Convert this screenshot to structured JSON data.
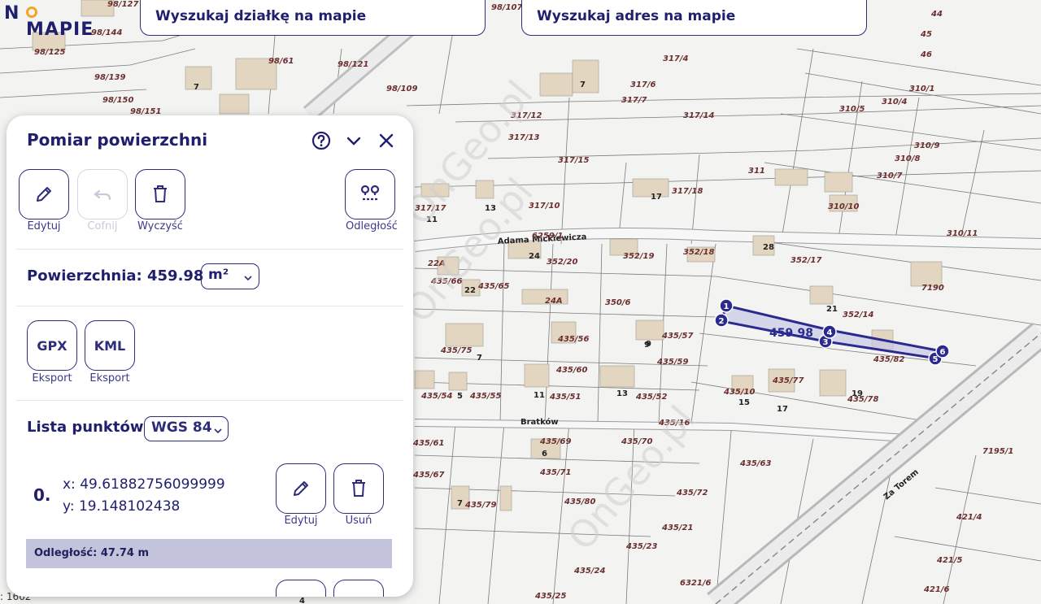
{
  "logo": {
    "n": "N",
    "word": "MAPIE"
  },
  "search": {
    "parcel": "Wyszukaj działkę na mapie",
    "address": "Wyszukaj adres na mapie"
  },
  "scale_text": ": 1662",
  "map": {
    "watermark": "OnGeo.pl",
    "measure_value": "459.98",
    "vertex_labels": [
      "1",
      "2",
      "3",
      "4",
      "5",
      "6"
    ],
    "street_labels": [
      "Adama Mickiewicza",
      "Bratków",
      "Za Torem"
    ],
    "parcel_labels": [
      "98/127",
      "98/125",
      "98/144",
      "98/139",
      "98/150",
      "98/151",
      "98/61",
      "98/121",
      "98/109",
      "98/107",
      "317/4",
      "317/6",
      "317/7",
      "317/12",
      "317/13",
      "317/14",
      "317/15",
      "317/10",
      "317/18",
      "317/17",
      "310/1",
      "310/4",
      "310/5",
      "310/9",
      "310/8",
      "310/7",
      "310/10",
      "310/11",
      "311",
      "352/19",
      "352/18",
      "352/17",
      "352/20",
      "352/14",
      "6259/1",
      "435/66",
      "435/65",
      "350/6",
      "435/56",
      "435/57",
      "435/59",
      "435/60",
      "435/75",
      "435/54",
      "435/55",
      "435/51",
      "435/52",
      "435/16",
      "435/10",
      "435/77",
      "435/78",
      "435/82",
      "435/80",
      "435/69",
      "435/70",
      "435/71",
      "435/72",
      "435/61",
      "435/67",
      "435/79",
      "435/63",
      "435/21",
      "435/23",
      "435/24",
      "435/25",
      "6321/6",
      "7195/1",
      "7190",
      "421/4",
      "421/5",
      "421/6",
      "44",
      "45",
      "46",
      "22A",
      "24A"
    ],
    "building_labels": [
      "7",
      "7",
      "9",
      "13",
      "11",
      "17",
      "24",
      "22",
      "28",
      "21",
      "7",
      "9",
      "6",
      "11",
      "13",
      "5",
      "15",
      "17",
      "19",
      "7",
      "4"
    ]
  },
  "panel": {
    "title": "Pomiar powierzchni",
    "tools": {
      "edit": "Edytuj",
      "undo": "Cofnij",
      "clear": "Wyczyść",
      "distance": "Odległość"
    },
    "area_label": "Powierzchnia: 459.98",
    "unit": "m²",
    "export": {
      "gpx": "GPX",
      "kml": "KML",
      "label": "Eksport"
    },
    "list_label": "Lista punktów",
    "crs": "WGS 84",
    "points": [
      {
        "index": "0.",
        "x": "x: 49.61882756099999",
        "y": "y: 19.148102438",
        "edit": "Edytuj",
        "delete": "Usuń"
      }
    ],
    "distance_text": "Odległość: 47.74 m"
  },
  "colors": {
    "accent": "#2d2d7a",
    "brand_orange": "#f2a52a",
    "polygon": "#2a2a8f",
    "highlight_row": "#c3c3db"
  },
  "icons": [
    "help-icon",
    "chevron-down-icon",
    "close-icon",
    "pencil-icon",
    "undo-icon",
    "trash-icon",
    "route-icon"
  ]
}
